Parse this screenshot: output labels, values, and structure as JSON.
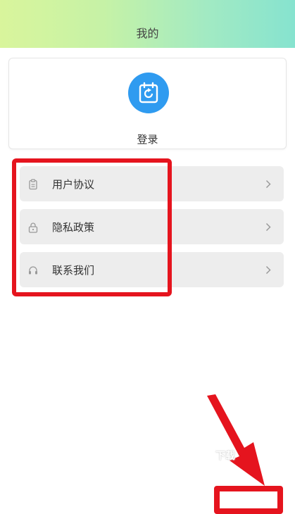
{
  "header": {
    "title": "我的"
  },
  "profile": {
    "login_label": "登录",
    "avatar_icon": "calendar-refresh-icon",
    "avatar_color": "#2f9bf0"
  },
  "menu": {
    "items": [
      {
        "label": "用户协议",
        "icon": "clipboard-icon"
      },
      {
        "label": "隐私政策",
        "icon": "lock-icon"
      },
      {
        "label": "联系我们",
        "icon": "headset-icon"
      }
    ]
  },
  "overlay": {
    "download_text": "下载",
    "highlight_color": "#e5141e"
  }
}
